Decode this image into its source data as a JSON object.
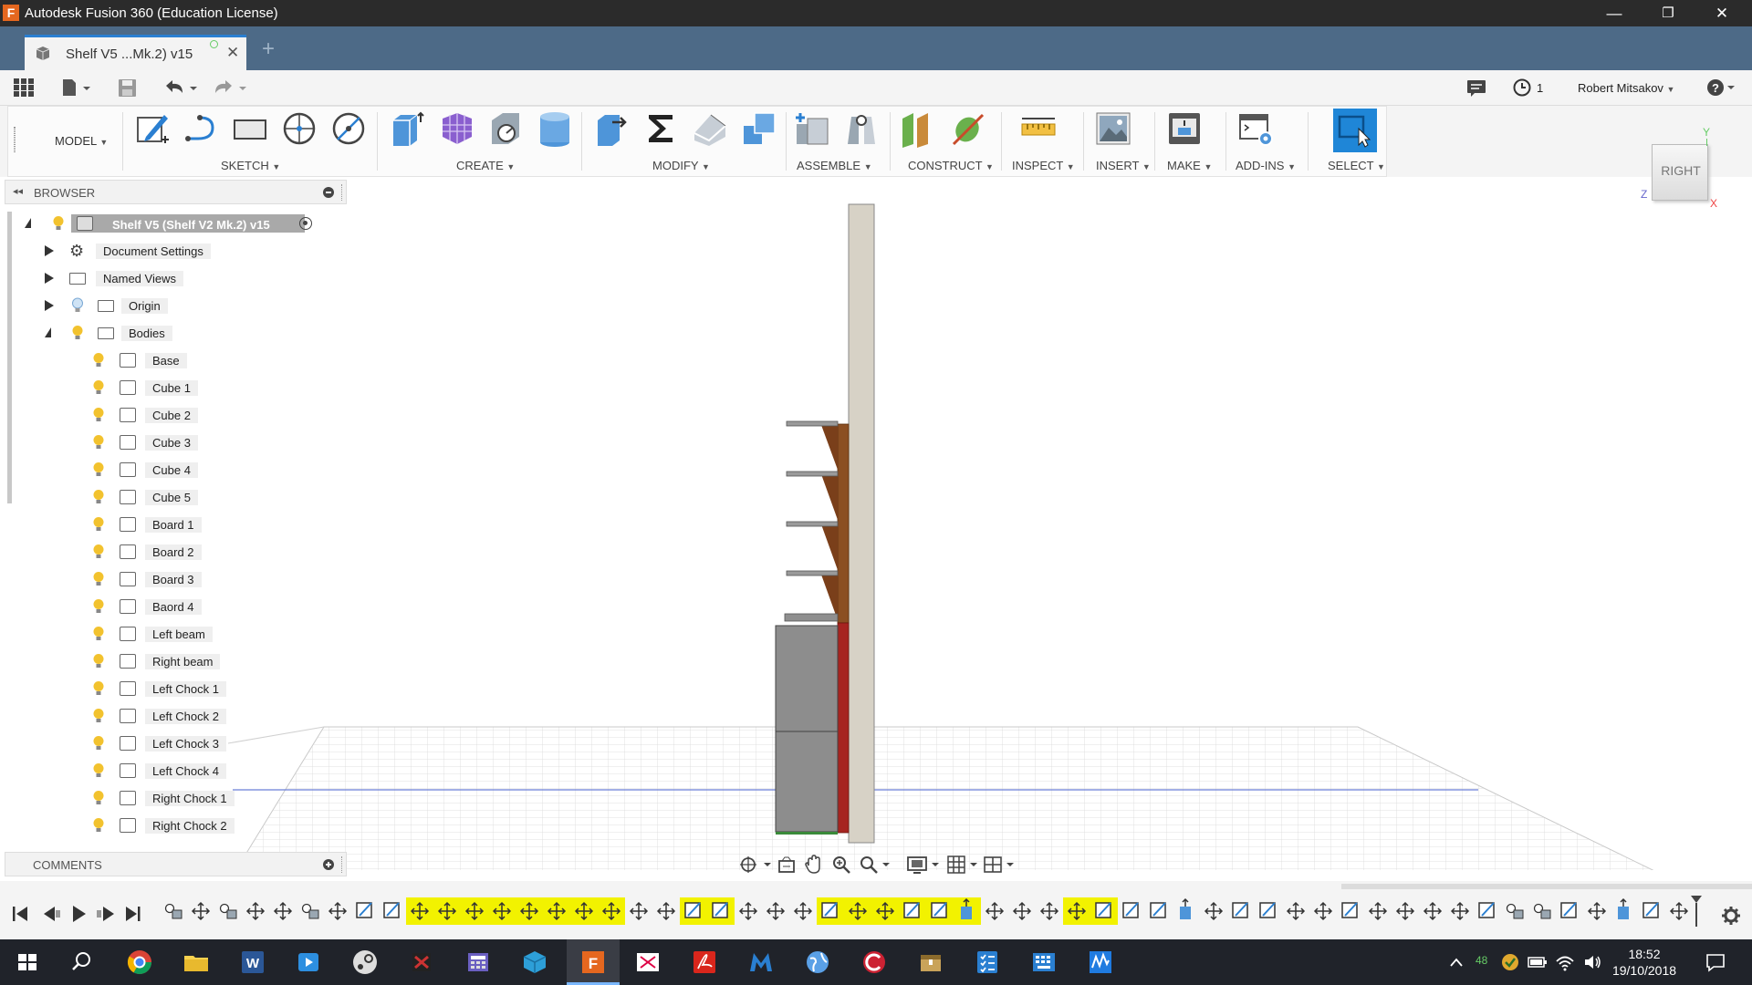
{
  "window": {
    "title": "Autodesk Fusion 360 (Education License)",
    "minimize": "—",
    "maximize": "❐",
    "close": "✕"
  },
  "tab": {
    "label": "Shelf V5 ...Mk.2) v15",
    "close": "✕",
    "new": "+"
  },
  "quick_access": {
    "job_status_count": "1",
    "user_name": "Robert Mitsakov"
  },
  "toolbar": {
    "workspace": "MODEL",
    "groups": [
      "SKETCH",
      "CREATE",
      "MODIFY",
      "ASSEMBLE",
      "CONSTRUCT",
      "INSPECT",
      "INSERT",
      "MAKE",
      "ADD-INS",
      "SELECT"
    ]
  },
  "browser": {
    "header": "BROWSER",
    "root": "Shelf V5 (Shelf V2 Mk.2) v15",
    "folders": [
      "Document Settings",
      "Named Views",
      "Origin",
      "Bodies"
    ],
    "bodies": [
      "Base",
      "Cube 1",
      "Cube 2",
      "Cube 3",
      "Cube 4",
      "Cube 5",
      "Board 1",
      "Board 2",
      "Board 3",
      "Baord 4",
      "Left beam",
      "Right beam",
      "Left Chock 1",
      "Left Chock 2",
      "Left Chock 3",
      "Left Chock 4",
      "Right Chock 1",
      "Right Chock 2"
    ]
  },
  "comments": {
    "header": "COMMENTS"
  },
  "viewcube": {
    "face": "RIGHT",
    "axis_y": "Y",
    "axis_z": "Z",
    "axis_x": "X"
  },
  "taskbar": {
    "time": "18:52",
    "date": "19/10/2018",
    "badge": "48"
  },
  "colors": {
    "title_bar": "#2b2b2b",
    "tab_bar": "#4d6a87",
    "accent": "#1f86d7",
    "timeline_highlight": "#f2f200",
    "taskbar": "#20232a"
  }
}
